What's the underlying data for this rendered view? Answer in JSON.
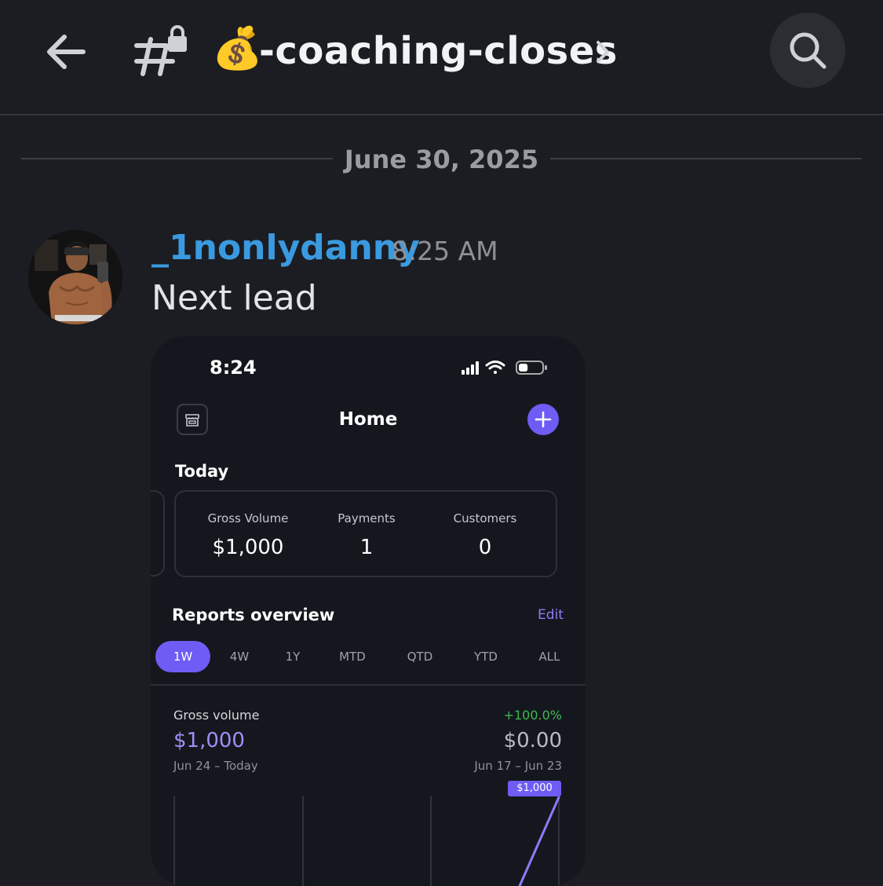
{
  "header": {
    "channel_emoji": "💰",
    "channel_name": "-coaching-closes",
    "icons": [
      "back-arrow-icon",
      "locked-channel-icon",
      "chevron-right-icon",
      "search-icon"
    ]
  },
  "date_divider": "June 30, 2025",
  "message": {
    "username": "_1nonlydanny",
    "timestamp": "8:25 AM",
    "text": "Next lead",
    "username_color": "#3a9ae0"
  },
  "attachment": {
    "status_time": "8:24",
    "battery_level": 0.4,
    "title": "Home",
    "today_label": "Today",
    "stats": [
      {
        "label": "Gross Volume",
        "value": "$1,000"
      },
      {
        "label": "Payments",
        "value": "1"
      },
      {
        "label": "Customers",
        "value": "0"
      }
    ],
    "reports_title": "Reports overview",
    "edit_label": "Edit",
    "ranges": [
      "1W",
      "4W",
      "1Y",
      "MTD",
      "QTD",
      "YTD",
      "ALL"
    ],
    "active_range": "1W",
    "gross_volume": {
      "label": "Gross volume",
      "value": "$1,000",
      "range": "Jun 24 – Today",
      "change": "+100.0%",
      "previous_value": "$0.00",
      "previous_range": "Jun 17 – Jun 23",
      "tooltip": "$1,000"
    },
    "accent_color": "#6e5cf5",
    "positive_color": "#3fb950"
  }
}
